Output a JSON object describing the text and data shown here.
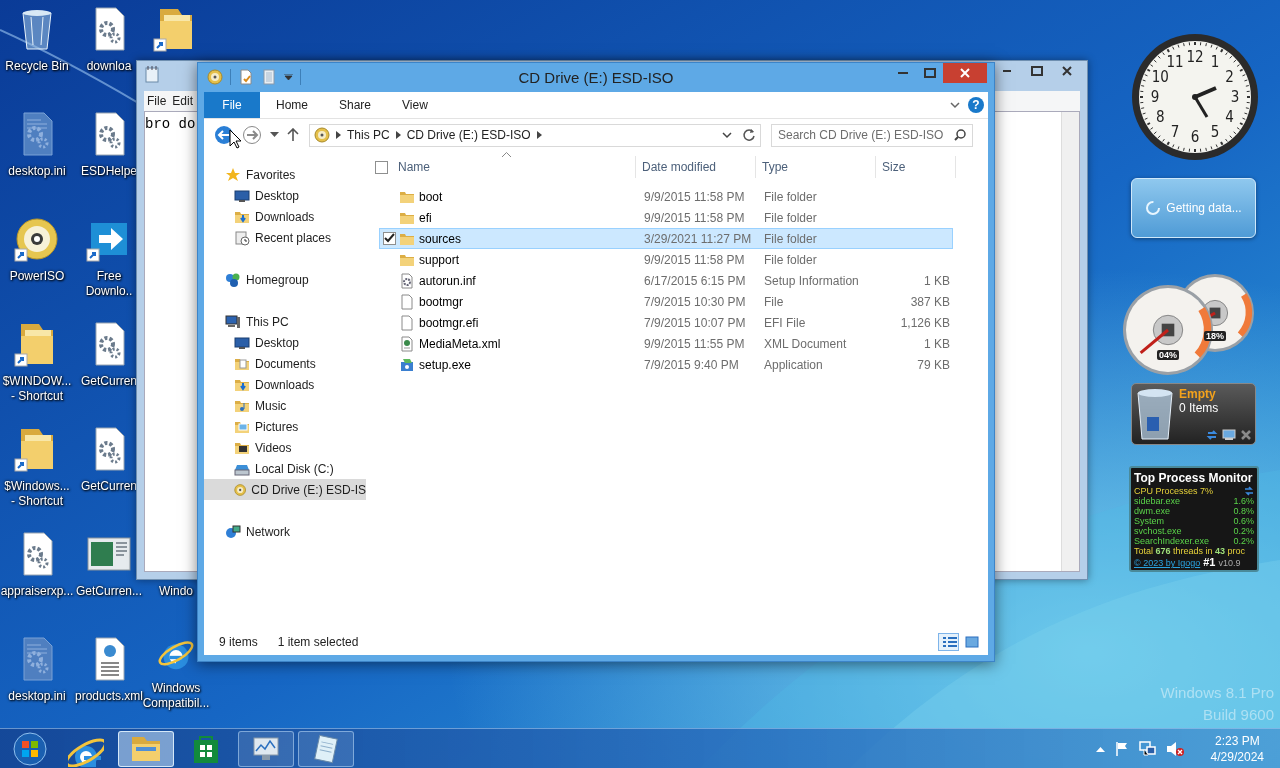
{
  "desktop": {
    "columns": [
      [
        {
          "label_lines": [
            "Recycle Bin"
          ],
          "kind": "recycle-bin",
          "shortcut": false
        },
        {
          "label_lines": [
            "desktop.ini"
          ],
          "kind": "settings-file",
          "shortcut": false
        },
        {
          "label_lines": [
            "PowerISO"
          ],
          "kind": "disc",
          "shortcut": true
        },
        {
          "label_lines": [
            "$WINDOW...",
            "- Shortcut"
          ],
          "kind": "folder",
          "shortcut": true
        },
        {
          "label_lines": [
            "$Windows...",
            "- Shortcut"
          ],
          "kind": "folder",
          "shortcut": true
        },
        {
          "label_lines": [
            "appraiserxp..."
          ],
          "kind": "gear-file",
          "shortcut": false
        },
        {
          "label_lines": [
            "desktop.ini"
          ],
          "kind": "settings-file",
          "shortcut": false
        }
      ],
      [
        {
          "label_lines": [
            "downloa"
          ],
          "kind": "gear-file",
          "shortcut": false
        },
        {
          "label_lines": [
            "ESDHelpe"
          ],
          "kind": "gear-file",
          "shortcut": false
        },
        {
          "label_lines": [
            "Free",
            "Downlo.."
          ],
          "kind": "arrow-app",
          "shortcut": true
        },
        {
          "label_lines": [
            "GetCurren"
          ],
          "kind": "gear-file",
          "shortcut": false
        },
        {
          "label_lines": [
            "GetCurren"
          ],
          "kind": "gear-file",
          "shortcut": false
        },
        {
          "label_lines": [
            "GetCurren..."
          ],
          "kind": "screenshot",
          "shortcut": false
        },
        {
          "label_lines": [
            "products.xml"
          ],
          "kind": "xml-file",
          "shortcut": false
        }
      ],
      [
        {
          "kind": "folder",
          "shortcut": true
        },
        {
          "label_lines": [
            "Windo"
          ],
          "kind": "covered"
        },
        {
          "label_lines": [
            "Windows",
            "Compatibil..."
          ],
          "kind": "browser",
          "shortcut": false
        }
      ]
    ]
  },
  "os_edition": [
    "Windows 8.1 Pro",
    "Build 9600"
  ],
  "notepad": {
    "menu": [
      "File",
      "Edit"
    ],
    "text": "bro do"
  },
  "explorer": {
    "title": "CD Drive (E:) ESD-ISO",
    "ribbon_tabs": [
      {
        "label": "File",
        "kind": "file",
        "selected": false
      },
      {
        "label": "Home",
        "kind": "tab",
        "selected": false
      },
      {
        "label": "Share",
        "kind": "tab",
        "selected": false
      },
      {
        "label": "View",
        "kind": "tab",
        "selected": false
      }
    ],
    "help": "?",
    "address": {
      "crumbs": [
        "This PC",
        "CD Drive (E:) ESD-ISO"
      ]
    },
    "search": {
      "placeholder": "Search CD Drive (E:) ESD-ISO"
    },
    "nav": [
      {
        "label": "Favorites",
        "kind": "star",
        "selected": false,
        "children": [
          {
            "label": "Desktop",
            "kind": "desktop",
            "selected": false
          },
          {
            "label": "Downloads",
            "kind": "downloads",
            "selected": false
          },
          {
            "label": "Recent places",
            "kind": "recent",
            "selected": false
          }
        ]
      },
      {
        "label": "Homegroup",
        "kind": "homegroup",
        "selected": false
      },
      {
        "label": "This PC",
        "kind": "pc",
        "selected": false,
        "children": [
          {
            "label": "Desktop",
            "kind": "desktop",
            "selected": false
          },
          {
            "label": "Documents",
            "kind": "documents",
            "selected": false
          },
          {
            "label": "Downloads",
            "kind": "downloads",
            "selected": false
          },
          {
            "label": "Music",
            "kind": "music",
            "selected": false
          },
          {
            "label": "Pictures",
            "kind": "pictures",
            "selected": false
          },
          {
            "label": "Videos",
            "kind": "videos",
            "selected": false
          },
          {
            "label": "Local Disk (C:)",
            "kind": "disk",
            "selected": false
          },
          {
            "label": "CD Drive (E:) ESD-IS",
            "kind": "disc",
            "selected": true
          }
        ]
      },
      {
        "label": "Network",
        "kind": "network",
        "selected": false
      }
    ],
    "columns": [
      "Name",
      "Date modified",
      "Type",
      "Size"
    ],
    "select_all": {
      "checked": false
    },
    "files": [
      {
        "name": "boot",
        "date": "9/9/2015 11:58 PM",
        "type": "File folder",
        "kind": "folder",
        "selected": false
      },
      {
        "name": "efi",
        "date": "9/9/2015 11:58 PM",
        "type": "File folder",
        "kind": "folder",
        "selected": false
      },
      {
        "name": "sources",
        "date": "3/29/2021 11:27 PM",
        "type": "File folder",
        "kind": "folder",
        "selected": true
      },
      {
        "name": "support",
        "date": "9/9/2015 11:58 PM",
        "type": "File folder",
        "kind": "folder",
        "selected": false
      },
      {
        "name": "autorun.inf",
        "date": "6/17/2015 6:15 PM",
        "type": "Setup Information",
        "size": "1 KB",
        "kind": "settings-file",
        "selected": false
      },
      {
        "name": "bootmgr",
        "date": "7/9/2015 10:30 PM",
        "type": "File",
        "size": "387 KB",
        "kind": "file",
        "selected": false
      },
      {
        "name": "bootmgr.efi",
        "date": "7/9/2015 10:07 PM",
        "type": "EFI File",
        "size": "1,126 KB",
        "kind": "file",
        "selected": false
      },
      {
        "name": "MediaMeta.xml",
        "date": "9/9/2015 11:55 PM",
        "type": "XML Document",
        "size": "1 KB",
        "kind": "xml",
        "selected": false
      },
      {
        "name": "setup.exe",
        "date": "7/9/2015 9:40 PM",
        "type": "Application",
        "size": "79 KB",
        "kind": "setup",
        "selected": false
      }
    ],
    "status": {
      "count": "9 items",
      "selection": "1 item selected"
    },
    "views": [
      {
        "kind": "details",
        "selected": true
      },
      {
        "kind": "large-icons",
        "selected": false
      }
    ]
  },
  "gadgets": {
    "clock": {
      "numeral_rows": [
        [
          "11",
          "12",
          "1"
        ],
        [
          "10",
          "2"
        ],
        [
          "9",
          "3"
        ],
        [
          "8",
          "4"
        ],
        [
          "7",
          "5"
        ],
        [
          "6"
        ]
      ]
    },
    "weather": {
      "message": "Getting data..."
    },
    "cpu_meter": {
      "cpu": {
        "reading": "04%"
      },
      "memory": {
        "reading": "18%"
      }
    },
    "recycle_bin": {
      "status": "Empty",
      "count": "0 Items"
    },
    "top_process": {
      "title": "Top Process Monitor",
      "summary": "CPU Processes 7%",
      "processes": [
        {
          "name": "sidebar.exe",
          "value": "1.6%"
        },
        {
          "name": "dwm.exe",
          "value": "0.8%"
        },
        {
          "name": "System",
          "value": "0.6%"
        },
        {
          "name": "svchost.exe",
          "value": "0.2%"
        },
        {
          "name": "SearchIndexer.exe",
          "value": "0.2%"
        }
      ],
      "totals": "Total **676** threads in **43** proc",
      "link": "© 2023 by Igogo",
      "rank": "#1",
      "version": "v10.9"
    }
  },
  "taskbar": {
    "buttons": [
      {
        "kind": "start",
        "open": false,
        "active": false
      },
      {
        "kind": "browser",
        "open": false,
        "active": false
      },
      {
        "kind": "file-explorer",
        "open": true,
        "active": true
      },
      {
        "kind": "store",
        "open": false,
        "active": false
      },
      {
        "kind": "performance",
        "open": true,
        "active": false
      },
      {
        "kind": "notepad",
        "open": true,
        "active": false
      }
    ],
    "time": "2:23 PM",
    "date": "4/29/2024"
  }
}
